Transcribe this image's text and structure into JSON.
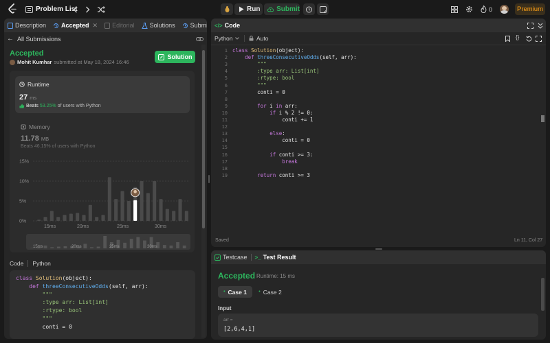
{
  "topbar": {
    "title": "Problem List",
    "run_label": "Run",
    "submit_label": "Submit",
    "streak_count": "0",
    "premium_label": "Premium"
  },
  "left_tabs": {
    "description": "Description",
    "accepted": "Accepted",
    "editorial": "Editorial",
    "solutions": "Solutions",
    "submissions": "Submissions"
  },
  "submission": {
    "back_label": "All Submissions",
    "status": "Accepted",
    "user": "Mohit Kumhar",
    "submitted_text": "submitted at May 18, 2024 16:46",
    "solution_button": "Solution",
    "runtime_label": "Runtime",
    "runtime_value": "27",
    "runtime_unit": "ms",
    "runtime_beats_prefix": "Beats",
    "runtime_beats": "53.25%",
    "runtime_beats_suffix": "of users with Python",
    "memory_label": "Memory",
    "memory_value": "11.78",
    "memory_unit": "MB",
    "memory_beats_text": "Beats 46.15% of users with Python",
    "code_label": "Code",
    "code_lang": "Python"
  },
  "chart_data": {
    "type": "bar",
    "y_ticks": [
      "15%",
      "10%",
      "5%",
      "0%"
    ],
    "ylim": [
      0,
      15
    ],
    "x_ticks": [
      "15ms",
      "20ms",
      "25ms",
      "30ms"
    ],
    "values": [
      0.3,
      1.0,
      2.5,
      1.0,
      1.5,
      1.8,
      2.0,
      1.5,
      4.0,
      1.0,
      1.5,
      11.0,
      5.5,
      7.5,
      5.0,
      8.5,
      10.0,
      7.0,
      10.0,
      5.5,
      3.0,
      2.5,
      5.5,
      2.5
    ],
    "highlight_index": 15,
    "highlight_value": 5.2,
    "mini_x_ticks": [
      "15ms",
      "20ms",
      "25ms",
      "30ms"
    ]
  },
  "code_panel": {
    "title": "Code",
    "language": "Python",
    "mode": "Auto",
    "status": "Saved",
    "cursor": "Ln 11, Col 27",
    "lines": [
      "class Solution(object):",
      "    def threeConsecutiveOdds(self, arr):",
      "        \"\"\"",
      "        :type arr: List[int]",
      "        :rtype: bool",
      "        \"\"\"",
      "        conti = 0",
      "",
      "        for i in arr:",
      "            if i % 2 != 0:",
      "                conti += 1",
      "",
      "            else:",
      "                conti = 0",
      "",
      "            if conti >= 3:",
      "                break",
      "",
      "        return conti >= 3"
    ]
  },
  "preview_code": [
    "class Solution(object):",
    "    def threeConsecutiveOdds(self, arr):",
    "        \"\"\"",
    "        :type arr: List[int]",
    "        :rtype: bool",
    "        \"\"\"",
    "        conti = 0"
  ],
  "result_panel": {
    "testcase_tab": "Testcase",
    "result_tab": "Test Result",
    "status": "Accepted",
    "runtime_text": "Runtime: 15 ms",
    "case1": "Case 1",
    "case2": "Case 2",
    "input_label": "Input",
    "var_label": "arr =",
    "var_value": "[2,6,4,1]"
  },
  "colors": {
    "accent_green": "#2db55d",
    "premium": "#ffa116"
  }
}
